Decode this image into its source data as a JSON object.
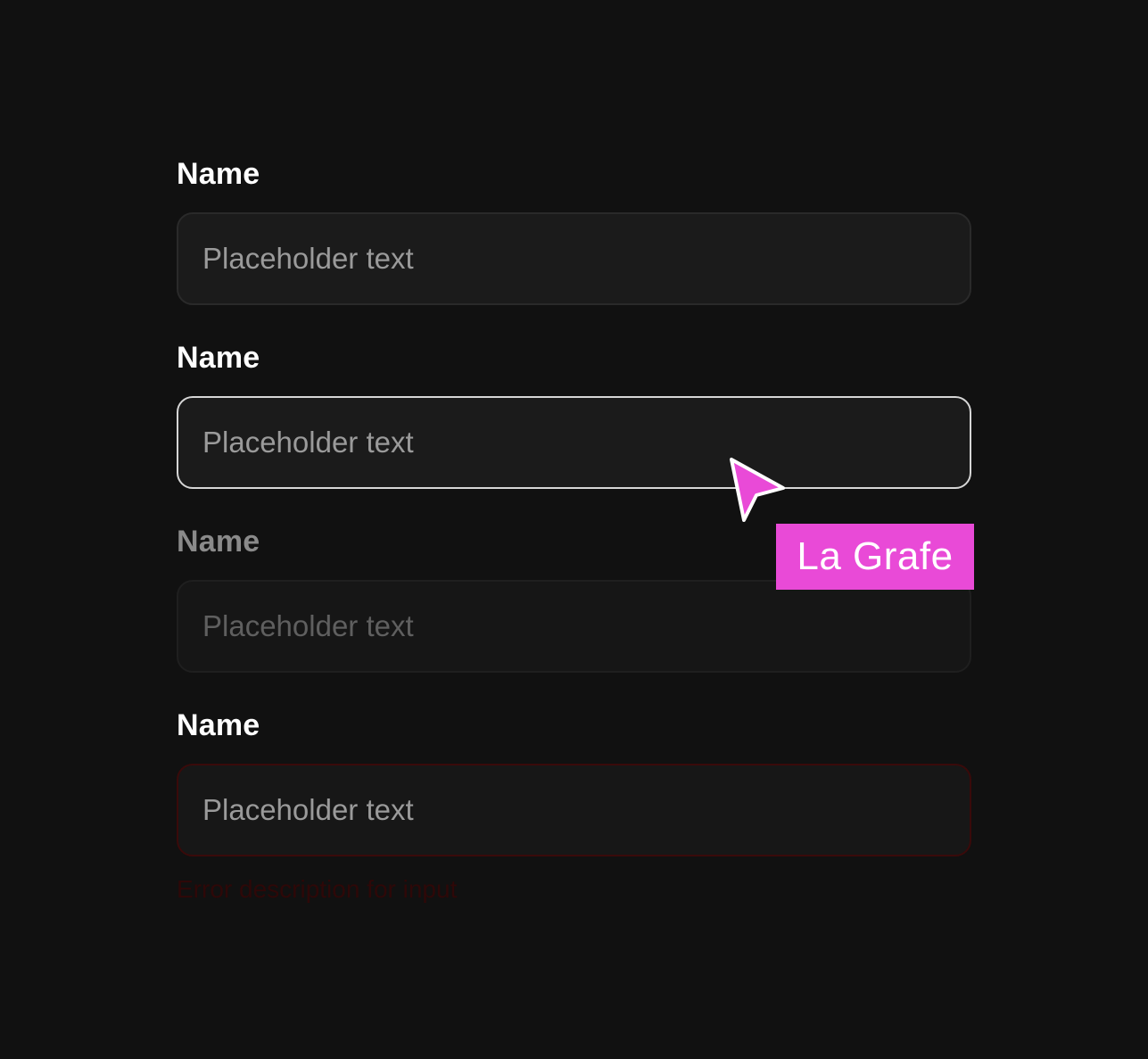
{
  "fields": [
    {
      "label": "Name",
      "placeholder": "Placeholder text",
      "state": "default"
    },
    {
      "label": "Name",
      "placeholder": "Placeholder text",
      "state": "focused"
    },
    {
      "label": "Name",
      "placeholder": "Placeholder text",
      "state": "disabled"
    },
    {
      "label": "Name",
      "placeholder": "Placeholder text",
      "state": "error",
      "error": "Error description for input"
    }
  ],
  "cursor": {
    "icon": "pointer-arrow-icon",
    "tag_label": "La Grafe",
    "tag_color": "#e94ad7"
  },
  "colors": {
    "background": "#111111",
    "input_bg": "#1b1b1b",
    "focus_border": "#d6d6d6",
    "error_border": "#3a0a0a"
  }
}
